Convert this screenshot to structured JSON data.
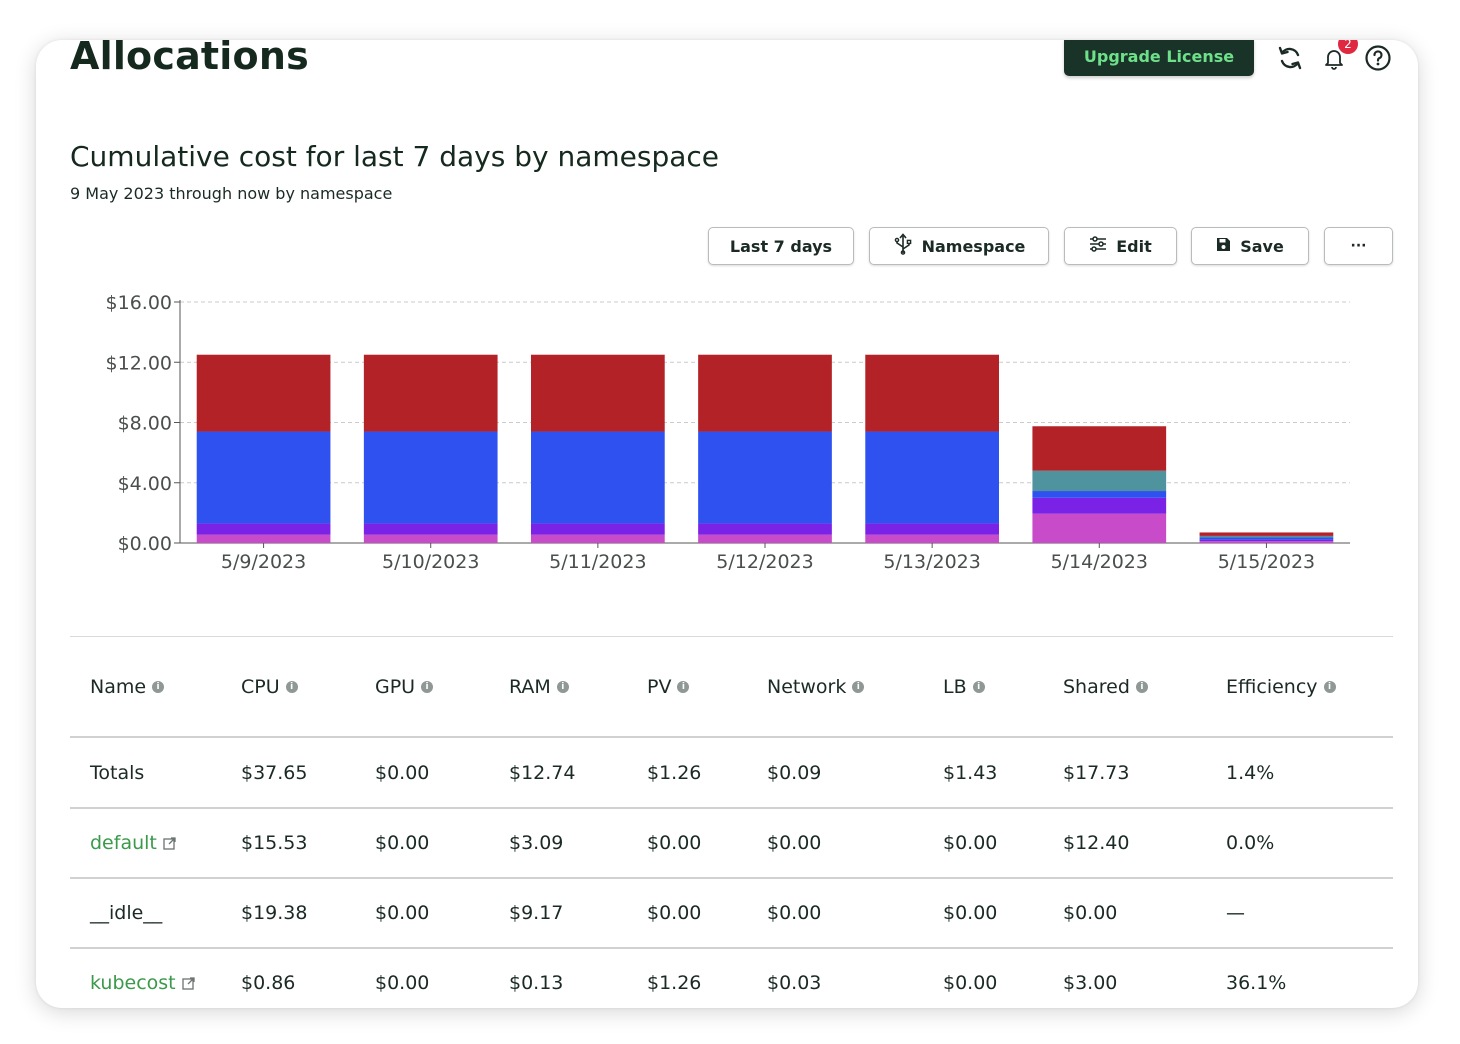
{
  "header": {
    "title": "Allocations",
    "upgrade_label": "Upgrade License",
    "notification_count": "2",
    "icons": [
      "refresh-icon",
      "bell-icon",
      "help-icon"
    ]
  },
  "report": {
    "title": "Cumulative cost for last 7 days by namespace",
    "subtitle": "9 May 2023 through now by namespace"
  },
  "toolbar": {
    "range_label": "Last 7 days",
    "aggregate_label": "Namespace",
    "edit_label": "Edit",
    "save_label": "Save",
    "more_label": "···"
  },
  "chart_data": {
    "type": "bar",
    "stacked": true,
    "categories": [
      "5/9/2023",
      "5/10/2023",
      "5/11/2023",
      "5/12/2023",
      "5/13/2023",
      "5/14/2023",
      "5/15/2023"
    ],
    "series": [
      {
        "color": "#c84cc9",
        "values": [
          0.55,
          0.55,
          0.55,
          0.55,
          0.55,
          1.95,
          0.12
        ]
      },
      {
        "color": "#7a22e6",
        "values": [
          0.75,
          0.75,
          0.75,
          0.75,
          0.75,
          1.05,
          0.1
        ]
      },
      {
        "color": "#2f51f0",
        "values": [
          6.1,
          6.1,
          6.1,
          6.1,
          6.1,
          0.45,
          0.15
        ]
      },
      {
        "color": "#4e939e",
        "values": [
          0.0,
          0.0,
          0.0,
          0.0,
          0.0,
          1.35,
          0.1
        ]
      },
      {
        "color": "#b32226",
        "values": [
          5.1,
          5.1,
          5.1,
          5.1,
          5.1,
          2.95,
          0.23
        ]
      }
    ],
    "y_ticks": [
      "$0.00",
      "$4.00",
      "$8.00",
      "$12.00",
      "$16.00"
    ],
    "ylim": [
      0,
      16
    ],
    "grid": true
  },
  "table": {
    "columns": [
      "Name",
      "CPU",
      "GPU",
      "RAM",
      "PV",
      "Network",
      "LB",
      "Shared",
      "Efficiency"
    ],
    "rows": [
      {
        "name": "Totals",
        "link": false,
        "values": [
          "$37.65",
          "$0.00",
          "$12.74",
          "$1.26",
          "$0.09",
          "$1.43",
          "$17.73",
          "1.4%"
        ]
      },
      {
        "name": "default",
        "link": true,
        "values": [
          "$15.53",
          "$0.00",
          "$3.09",
          "$0.00",
          "$0.00",
          "$0.00",
          "$12.40",
          "0.0%"
        ]
      },
      {
        "name": "__idle__",
        "link": false,
        "values": [
          "$19.38",
          "$0.00",
          "$9.17",
          "$0.00",
          "$0.00",
          "$0.00",
          "$0.00",
          "—"
        ]
      },
      {
        "name": "kubecost",
        "link": true,
        "values": [
          "$0.86",
          "$0.00",
          "$0.13",
          "$1.26",
          "$0.03",
          "$0.00",
          "$3.00",
          "36.1%"
        ]
      }
    ]
  }
}
